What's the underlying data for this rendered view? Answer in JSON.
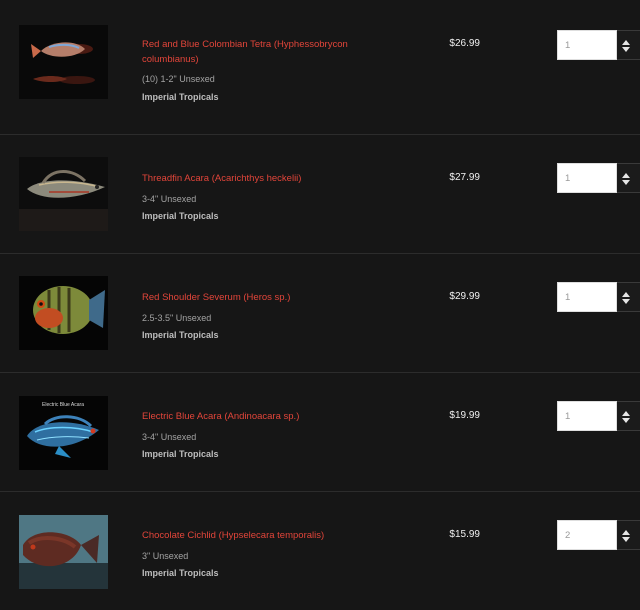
{
  "cart": {
    "items": [
      {
        "name": "Red and Blue Colombian Tetra (Hyphessobrycon columbianus)",
        "variant": "(10) 1-2\" Unsexed",
        "vendor": "Imperial Tropicals",
        "price": "$26.99",
        "quantity": "1",
        "image_icon": "fish-photo-icon"
      },
      {
        "name": "Threadfin Acara (Acarichthys heckelii)",
        "variant": "3-4\" Unsexed",
        "vendor": "Imperial Tropicals",
        "price": "$27.99",
        "quantity": "1",
        "image_icon": "fish-photo-icon"
      },
      {
        "name": "Red Shoulder Severum (Heros sp.)",
        "variant": "2.5-3.5\" Unsexed",
        "vendor": "Imperial Tropicals",
        "price": "$29.99",
        "quantity": "1",
        "image_icon": "fish-photo-icon"
      },
      {
        "name": "Electric Blue Acara (Andinoacara sp.)",
        "variant": "3-4\" Unsexed",
        "vendor": "Imperial Tropicals",
        "price": "$19.99",
        "quantity": "1",
        "image_icon": "fish-photo-icon",
        "image_caption": "Electric Blue Acara"
      },
      {
        "name": "Chocolate Cichlid (Hypselecara temporalis)",
        "variant": "3\" Unsexed",
        "vendor": "Imperial Tropicals",
        "price": "$15.99",
        "quantity": "2",
        "image_icon": "fish-photo-icon"
      }
    ]
  },
  "colors": {
    "background": "#161616",
    "product_name": "#e2453a",
    "text_muted": "#a3a3a3",
    "price": "#f0f0f0"
  }
}
